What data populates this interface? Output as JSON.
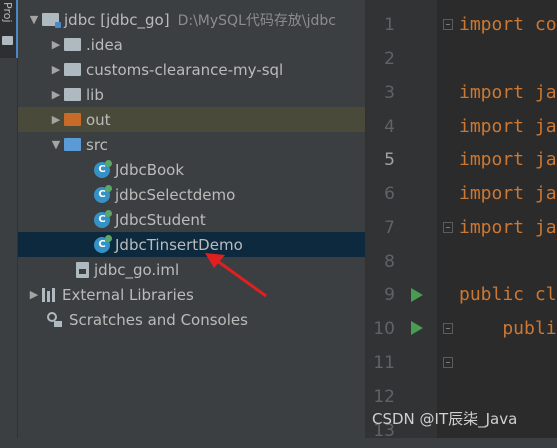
{
  "sidebar": {
    "tab_label": "Proj"
  },
  "tree": {
    "root": {
      "name": "jdbc [jdbc_go]",
      "path": "D:\\MySQL代码存放\\jdbc"
    },
    "items": [
      {
        "label": "jdbc [jdbc_go]",
        "path": "D:\\MySQL代码存放\\jdbc"
      },
      {
        "label": ".idea"
      },
      {
        "label": "customs-clearance-my-sql"
      },
      {
        "label": "lib"
      },
      {
        "label": "out"
      },
      {
        "label": "src"
      },
      {
        "label": "JdbcBook"
      },
      {
        "label": "jdbcSelectdemo"
      },
      {
        "label": "JdbcStudent"
      },
      {
        "label": "JdbcTinsertDemo"
      },
      {
        "label": "jdbc_go.iml"
      },
      {
        "label": "External Libraries"
      },
      {
        "label": "Scratches and Consoles"
      }
    ],
    "selected": "JdbcTinsertDemo"
  },
  "editor": {
    "current_line": 5,
    "lines": [
      {
        "n": "1",
        "text": "import co"
      },
      {
        "n": "2",
        "text": ""
      },
      {
        "n": "3",
        "text": "import ja"
      },
      {
        "n": "4",
        "text": "import ja"
      },
      {
        "n": "5",
        "text": "import ja"
      },
      {
        "n": "6",
        "text": "import ja"
      },
      {
        "n": "7",
        "text": "import ja"
      },
      {
        "n": "8",
        "text": ""
      },
      {
        "n": "9",
        "text": "public cl"
      },
      {
        "n": "10",
        "text": "    publi"
      },
      {
        "n": "11",
        "text": ""
      },
      {
        "n": "12",
        "text": ""
      },
      {
        "n": "13",
        "text": ""
      }
    ]
  },
  "watermark": "CSDN @IT辰柒_Java",
  "colors": {
    "accent": "#4a88c7",
    "selection": "#0d293e",
    "keyword": "#cc7832",
    "excluded_folder": "#c86b2a",
    "source_folder": "#5a9bd5",
    "arrow": "#e02020"
  }
}
